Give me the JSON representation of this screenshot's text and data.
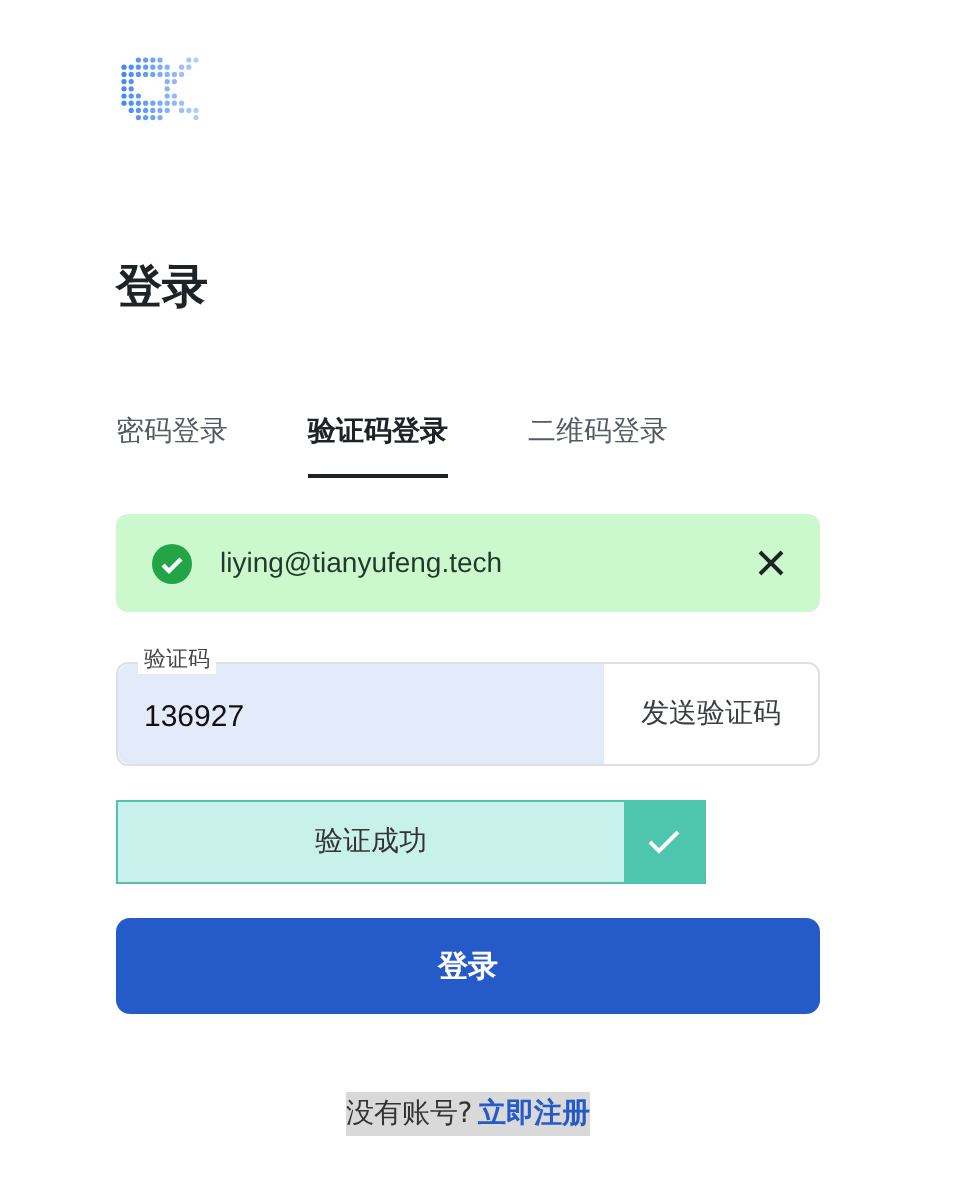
{
  "title": "登录",
  "tabs": [
    {
      "label": "密码登录",
      "selected": false
    },
    {
      "label": "验证码登录",
      "selected": true
    },
    {
      "label": "二维码登录",
      "selected": false
    }
  ],
  "alert": {
    "text": "liying@tianyufeng.tech"
  },
  "code_field": {
    "label": "验证码",
    "value": "136927"
  },
  "send_button": "发送验证码",
  "slider_verify": {
    "label": "验证成功",
    "verified": true
  },
  "login_button": "登录",
  "footer": {
    "prompt": "没有账号?",
    "link": "立即注册"
  }
}
